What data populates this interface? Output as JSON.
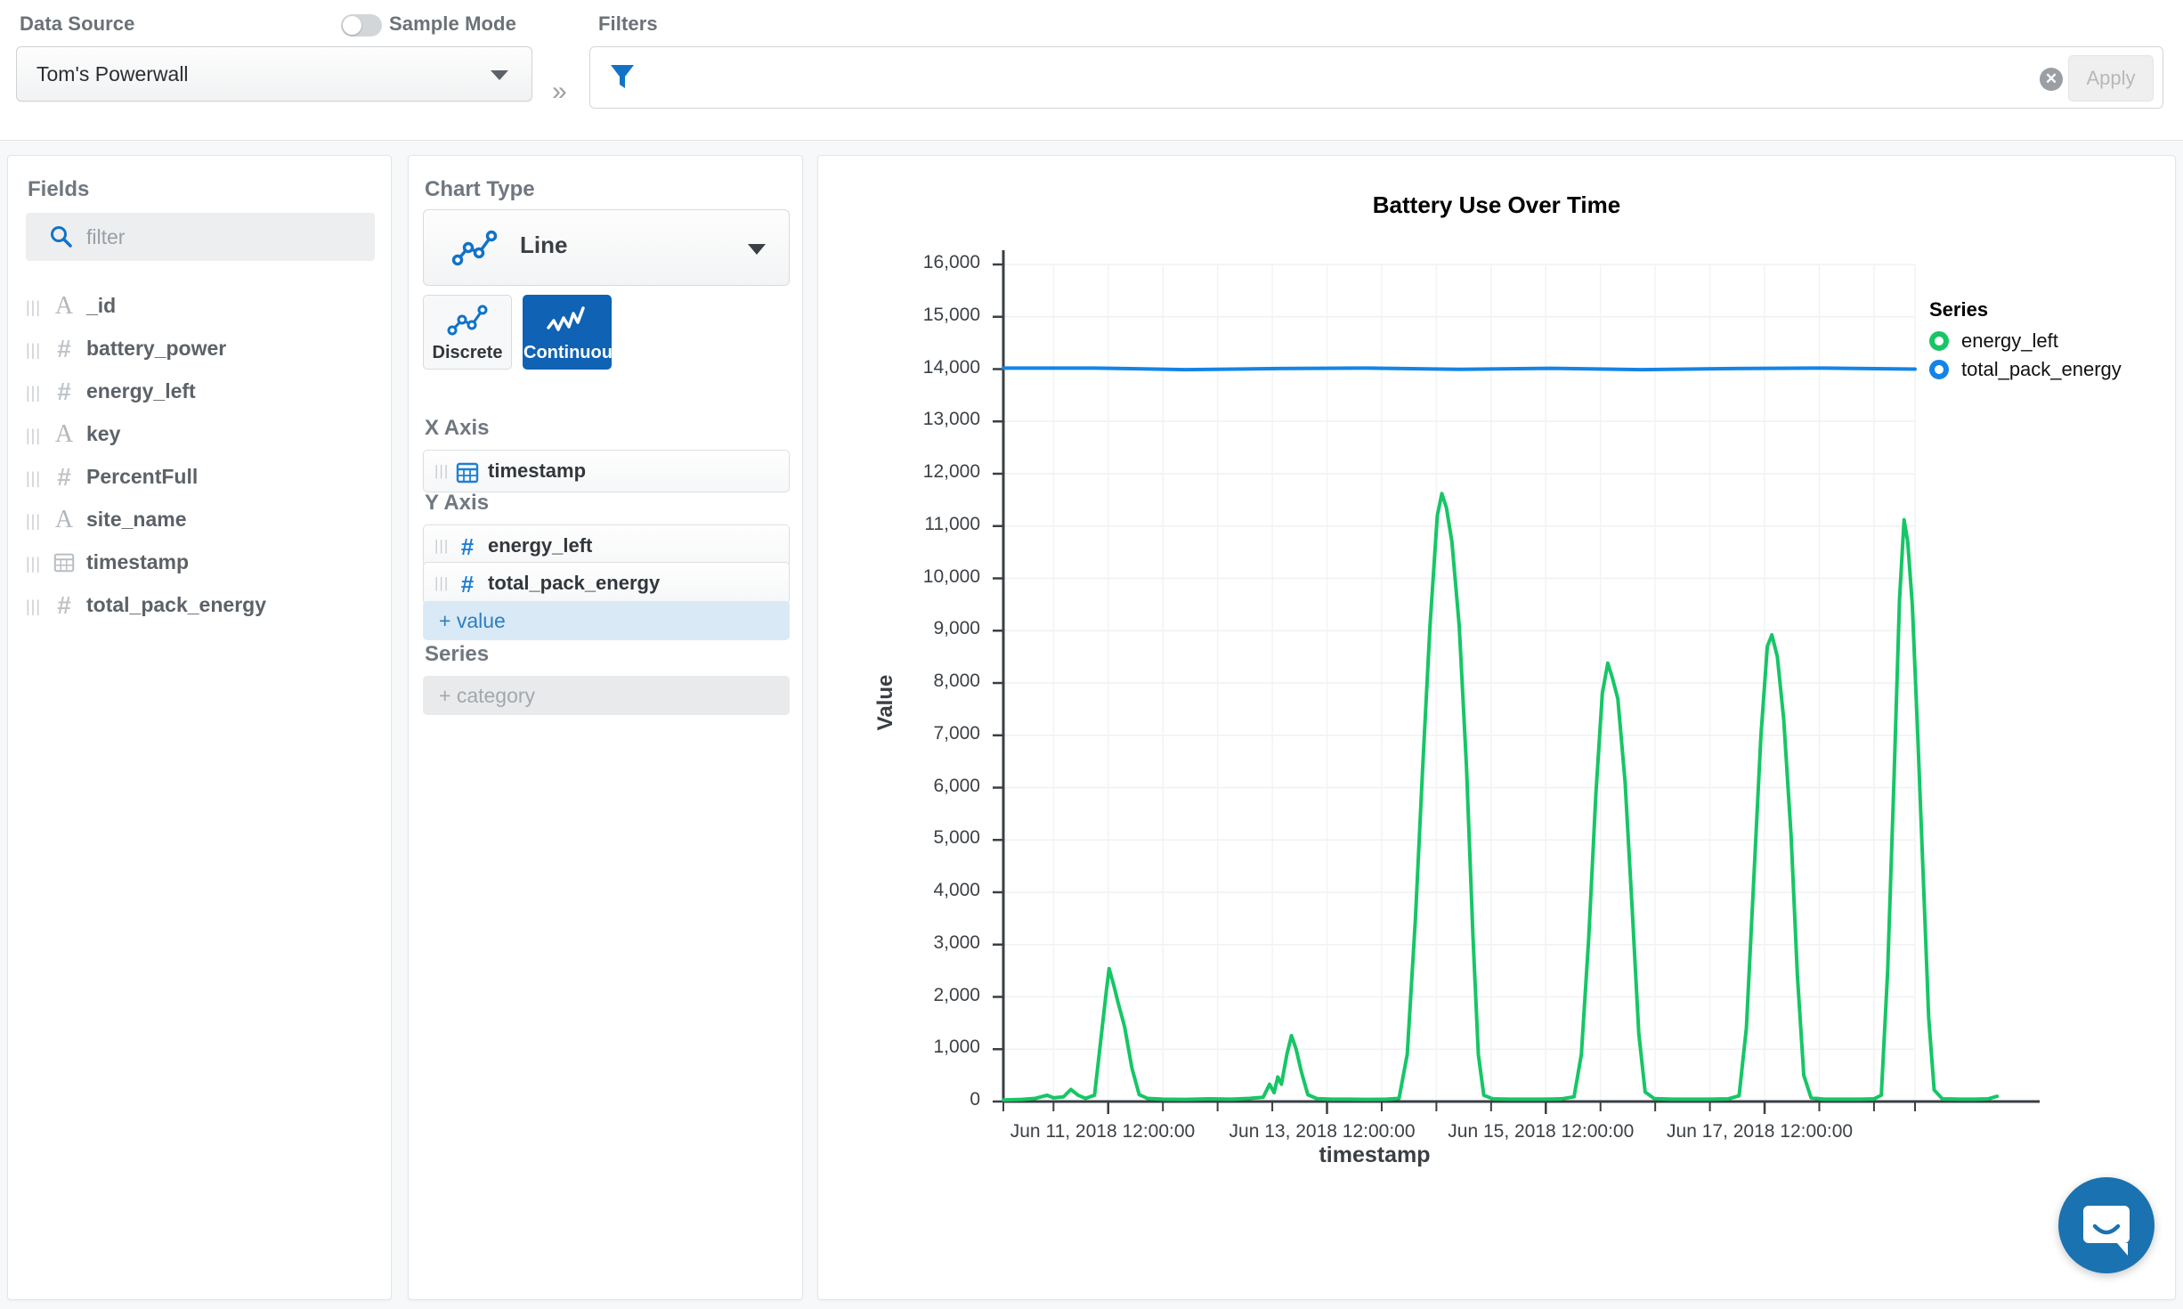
{
  "header": {
    "data_source_label": "Data Source",
    "sample_mode_label": "Sample Mode",
    "sample_mode_on": false,
    "filters_label": "Filters",
    "data_source_value": "Tom's Powerwall",
    "filter_value": "",
    "filter_placeholder": "",
    "apply_label": "Apply",
    "expand_icon": "»"
  },
  "fields": {
    "title": "Fields",
    "filter_placeholder": "filter",
    "filter_value": "",
    "items": [
      {
        "name": "_id",
        "type": "string"
      },
      {
        "name": "battery_power",
        "type": "number"
      },
      {
        "name": "energy_left",
        "type": "number"
      },
      {
        "name": "key",
        "type": "string"
      },
      {
        "name": "PercentFull",
        "type": "number"
      },
      {
        "name": "site_name",
        "type": "string"
      },
      {
        "name": "timestamp",
        "type": "date"
      },
      {
        "name": "total_pack_energy",
        "type": "number"
      }
    ]
  },
  "chart_panel": {
    "chart_type_label": "Chart Type",
    "chart_type_value": "Line",
    "mode_discrete_label": "Discrete",
    "mode_continuous_label": "Continuous",
    "mode_selected": "Continuous",
    "x_axis_label": "X Axis",
    "x_axis_field": "timestamp",
    "y_axis_label": "Y Axis",
    "y_axis_fields": [
      "energy_left",
      "total_pack_energy"
    ],
    "add_value_label": "+ value",
    "series_label": "Series",
    "add_category_label": "+ category"
  },
  "colors": {
    "accent_blue": "#0f62b4",
    "series_green": "#16c666",
    "series_blue": "#1484e6",
    "intercom_blue": "#1a72b0"
  },
  "chart_data": {
    "type": "line",
    "title": "Battery Use Over Time",
    "xlabel": "timestamp",
    "ylabel": "Value",
    "grid": true,
    "legend_position": "right",
    "legend_title": "Series",
    "ylim": [
      0,
      16000
    ],
    "yticks": [
      0,
      1000,
      2000,
      3000,
      4000,
      5000,
      6000,
      7000,
      8000,
      9000,
      10000,
      11000,
      12000,
      13000,
      14000,
      15000,
      16000
    ],
    "ytick_labels": [
      "0",
      "1,000",
      "2,000",
      "3,000",
      "4,000",
      "5,000",
      "6,000",
      "7,000",
      "8,000",
      "9,000",
      "10,000",
      "11,000",
      "12,000",
      "13,000",
      "14,000",
      "15,000",
      "16,000"
    ],
    "xticks": [
      0.115,
      0.355,
      0.595,
      0.835
    ],
    "xtick_labels": [
      "Jun 11, 2018 12:00:00",
      "Jun 13, 2018 12:00:00",
      "Jun 15, 2018 12:00:00",
      "Jun 17, 2018 12:00:00"
    ],
    "x_minor_ticks": [
      0.0,
      0.055,
      0.175,
      0.235,
      0.295,
      0.415,
      0.475,
      0.535,
      0.655,
      0.715,
      0.775,
      0.895,
      0.955,
      1.0
    ],
    "series": [
      {
        "name": "energy_left",
        "color": "#16c666",
        "points": [
          [
            0.0,
            30
          ],
          [
            0.02,
            40
          ],
          [
            0.035,
            60
          ],
          [
            0.048,
            120
          ],
          [
            0.055,
            70
          ],
          [
            0.066,
            90
          ],
          [
            0.074,
            230
          ],
          [
            0.082,
            120
          ],
          [
            0.09,
            60
          ],
          [
            0.1,
            120
          ],
          [
            0.108,
            1350
          ],
          [
            0.113,
            2120
          ],
          [
            0.116,
            2540
          ],
          [
            0.121,
            2230
          ],
          [
            0.126,
            1880
          ],
          [
            0.133,
            1430
          ],
          [
            0.141,
            640
          ],
          [
            0.149,
            130
          ],
          [
            0.158,
            60
          ],
          [
            0.175,
            45
          ],
          [
            0.2,
            40
          ],
          [
            0.225,
            50
          ],
          [
            0.25,
            45
          ],
          [
            0.27,
            60
          ],
          [
            0.285,
            80
          ],
          [
            0.292,
            330
          ],
          [
            0.297,
            170
          ],
          [
            0.301,
            470
          ],
          [
            0.305,
            330
          ],
          [
            0.311,
            900
          ],
          [
            0.316,
            1260
          ],
          [
            0.321,
            1010
          ],
          [
            0.327,
            560
          ],
          [
            0.334,
            130
          ],
          [
            0.344,
            55
          ],
          [
            0.36,
            45
          ],
          [
            0.38,
            45
          ],
          [
            0.4,
            40
          ],
          [
            0.42,
            45
          ],
          [
            0.434,
            60
          ],
          [
            0.443,
            900
          ],
          [
            0.452,
            3500
          ],
          [
            0.46,
            6400
          ],
          [
            0.468,
            9100
          ],
          [
            0.476,
            11200
          ],
          [
            0.481,
            11620
          ],
          [
            0.486,
            11350
          ],
          [
            0.492,
            10700
          ],
          [
            0.5,
            9100
          ],
          [
            0.508,
            6400
          ],
          [
            0.515,
            3200
          ],
          [
            0.521,
            900
          ],
          [
            0.527,
            120
          ],
          [
            0.537,
            50
          ],
          [
            0.555,
            45
          ],
          [
            0.575,
            45
          ],
          [
            0.595,
            45
          ],
          [
            0.612,
            50
          ],
          [
            0.626,
            90
          ],
          [
            0.634,
            900
          ],
          [
            0.642,
            3100
          ],
          [
            0.65,
            5900
          ],
          [
            0.657,
            7800
          ],
          [
            0.663,
            8380
          ],
          [
            0.668,
            8100
          ],
          [
            0.674,
            7700
          ],
          [
            0.682,
            6100
          ],
          [
            0.69,
            3600
          ],
          [
            0.697,
            1300
          ],
          [
            0.704,
            180
          ],
          [
            0.714,
            55
          ],
          [
            0.733,
            45
          ],
          [
            0.755,
            45
          ],
          [
            0.775,
            45
          ],
          [
            0.795,
            50
          ],
          [
            0.807,
            110
          ],
          [
            0.815,
            1400
          ],
          [
            0.823,
            4200
          ],
          [
            0.831,
            7000
          ],
          [
            0.838,
            8700
          ],
          [
            0.843,
            8920
          ],
          [
            0.849,
            8500
          ],
          [
            0.856,
            7300
          ],
          [
            0.864,
            5100
          ],
          [
            0.871,
            2400
          ],
          [
            0.878,
            500
          ],
          [
            0.886,
            70
          ],
          [
            0.9,
            45
          ],
          [
            0.92,
            45
          ],
          [
            0.94,
            45
          ],
          [
            0.955,
            50
          ],
          [
            0.963,
            120
          ],
          [
            0.97,
            2500
          ],
          [
            0.977,
            6200
          ],
          [
            0.983,
            9600
          ],
          [
            0.988,
            11120
          ],
          [
            0.992,
            10700
          ],
          [
            0.997,
            9500
          ],
          [
            1.003,
            7000
          ],
          [
            1.009,
            4300
          ],
          [
            1.015,
            1600
          ],
          [
            1.021,
            220
          ],
          [
            1.03,
            50
          ],
          [
            1.05,
            45
          ],
          [
            1.065,
            45
          ],
          [
            1.08,
            50
          ],
          [
            1.09,
            100
          ]
        ]
      },
      {
        "name": "total_pack_energy",
        "color": "#1484e6",
        "constant_value": 14000,
        "points": [
          [
            0.0,
            14020
          ],
          [
            0.1,
            14020
          ],
          [
            0.2,
            13990
          ],
          [
            0.3,
            14010
          ],
          [
            0.4,
            14020
          ],
          [
            0.5,
            13995
          ],
          [
            0.6,
            14015
          ],
          [
            0.7,
            13990
          ],
          [
            0.8,
            14010
          ],
          [
            0.9,
            14020
          ],
          [
            1.0,
            14000
          ]
        ]
      }
    ]
  }
}
